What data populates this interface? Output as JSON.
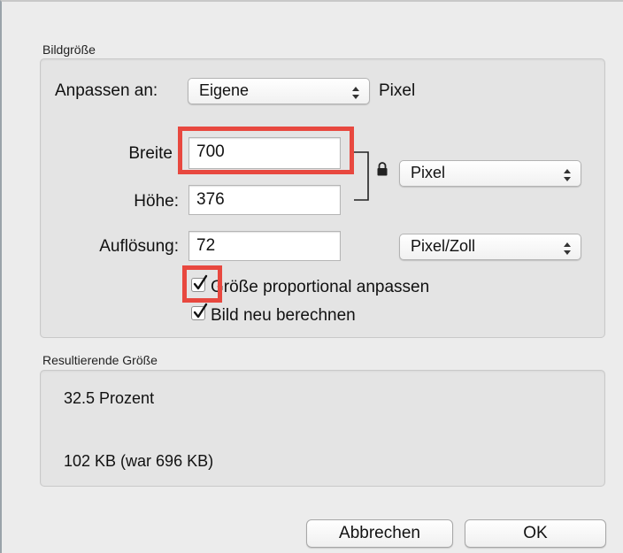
{
  "dialog": {
    "size_section": {
      "title": "Bildgröße",
      "fit_label": "Anpassen an:",
      "fit_value": "Eigene",
      "fit_unit": "Pixel",
      "width_label": "Breite",
      "width_value": "700",
      "height_label": "Höhe:",
      "height_value": "376",
      "unit_value": "Pixel",
      "resolution_label": "Auflösung:",
      "resolution_value": "72",
      "resolution_unit": "Pixel/Zoll",
      "proportional_label": "Größe proportional anpassen",
      "proportional_checked": true,
      "resample_label": "Bild neu berechnen",
      "resample_checked": true
    },
    "result_section": {
      "title": "Resultierende Größe",
      "percent": "32.5 Prozent",
      "filesize": "102 KB (war 696 KB)"
    },
    "buttons": {
      "cancel": "Abbrechen",
      "ok": "OK"
    },
    "colors": {
      "highlight": "#e8483f"
    },
    "icons": {
      "lock": "lock-icon",
      "popup_arrows": "up-down-arrows-icon",
      "checkmark": "checkmark-icon"
    }
  }
}
